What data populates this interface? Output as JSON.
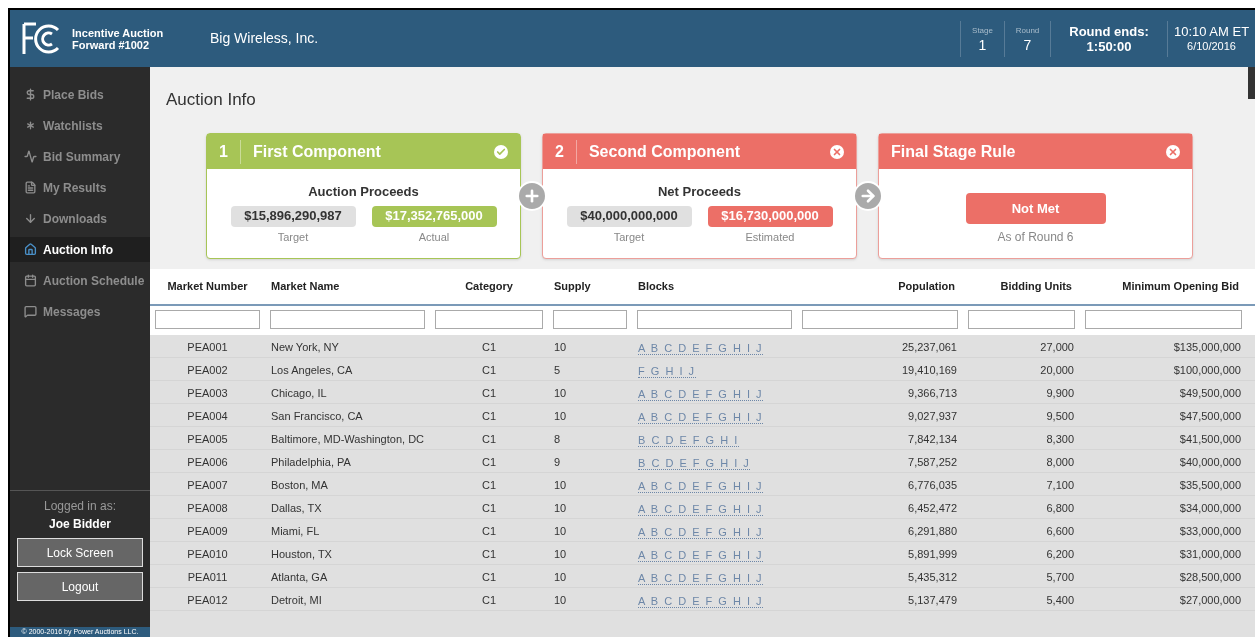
{
  "header": {
    "app_title": "Incentive Auction",
    "app_subtitle": "Forward #1002",
    "company": "Big Wireless, Inc.",
    "stage_label": "Stage",
    "stage": "1",
    "round_label": "Round",
    "round": "7",
    "round_ends_label": "Round ends:",
    "round_ends": "1:50:00",
    "time": "10:10 AM ET",
    "date": "6/10/2016"
  },
  "sidebar": {
    "items": [
      {
        "label": "Place Bids",
        "selected": false
      },
      {
        "label": "Watchlists",
        "selected": false
      },
      {
        "label": "Bid Summary",
        "selected": false
      },
      {
        "label": "My Results",
        "selected": false
      },
      {
        "label": "Downloads",
        "selected": false
      },
      {
        "label": "Auction Info",
        "selected": true
      },
      {
        "label": "Auction Schedule",
        "selected": false
      },
      {
        "label": "Messages",
        "selected": false
      }
    ],
    "logged_in_label": "Logged in as:",
    "user": "Joe Bidder",
    "buttons": [
      "Lock Screen",
      "Logout"
    ],
    "copyright": "© 2000-2016 by Power Auctions LLC."
  },
  "page_title": "Auction Info",
  "components": [
    {
      "number": "1",
      "title": "First Component",
      "met": true,
      "subtitle": "Auction Proceeds",
      "target": "$15,896,290,987",
      "target_label": "Target",
      "value": "$17,352,765,000",
      "value_label": "Actual"
    },
    {
      "number": "2",
      "title": "Second Component",
      "met": false,
      "subtitle": "Net Proceeds",
      "target": "$40,000,000,000",
      "target_label": "Target",
      "value": "$16,730,000,000",
      "value_label": "Estimated"
    },
    {
      "title": "Final Stage Rule",
      "met": false,
      "status": "Not Met",
      "note": "As of Round 6"
    }
  ],
  "table": {
    "columns": [
      "Market Number",
      "Market Name",
      "Category",
      "Supply",
      "Blocks",
      "Population",
      "Bidding Units",
      "Minimum Opening Bid"
    ],
    "rows": [
      [
        "PEA001",
        "New York, NY",
        "C1",
        "10",
        "A B C D E F G H I J",
        "25,237,061",
        "27,000",
        "$135,000,000"
      ],
      [
        "PEA002",
        "Los Angeles, CA",
        "C1",
        "5",
        "F G H I J",
        "19,410,169",
        "20,000",
        "$100,000,000"
      ],
      [
        "PEA003",
        "Chicago, IL",
        "C1",
        "10",
        "A B C D E F G H I J",
        "9,366,713",
        "9,900",
        "$49,500,000"
      ],
      [
        "PEA004",
        "San Francisco, CA",
        "C1",
        "10",
        "A B C D E F G H I J",
        "9,027,937",
        "9,500",
        "$47,500,000"
      ],
      [
        "PEA005",
        "Baltimore, MD-Washington, DC",
        "C1",
        "8",
        "B C D E F G H I",
        "7,842,134",
        "8,300",
        "$41,500,000"
      ],
      [
        "PEA006",
        "Philadelphia, PA",
        "C1",
        "9",
        "B C D E F G H I J",
        "7,587,252",
        "8,000",
        "$40,000,000"
      ],
      [
        "PEA007",
        "Boston, MA",
        "C1",
        "10",
        "A B C D E F G H I J",
        "6,776,035",
        "7,100",
        "$35,500,000"
      ],
      [
        "PEA008",
        "Dallas, TX",
        "C1",
        "10",
        "A B C D E F G H I J",
        "6,452,472",
        "6,800",
        "$34,000,000"
      ],
      [
        "PEA009",
        "Miami, FL",
        "C1",
        "10",
        "A B C D E F G H I J",
        "6,291,880",
        "6,600",
        "$33,000,000"
      ],
      [
        "PEA010",
        "Houston, TX",
        "C1",
        "10",
        "A B C D E F G H I J",
        "5,891,999",
        "6,200",
        "$31,000,000"
      ],
      [
        "PEA011",
        "Atlanta, GA",
        "C1",
        "10",
        "A B C D E F G H I J",
        "5,435,312",
        "5,700",
        "$28,500,000"
      ],
      [
        "PEA012",
        "Detroit, MI",
        "C1",
        "10",
        "A B C D E F G H I J",
        "5,137,479",
        "5,400",
        "$27,000,000"
      ]
    ]
  }
}
